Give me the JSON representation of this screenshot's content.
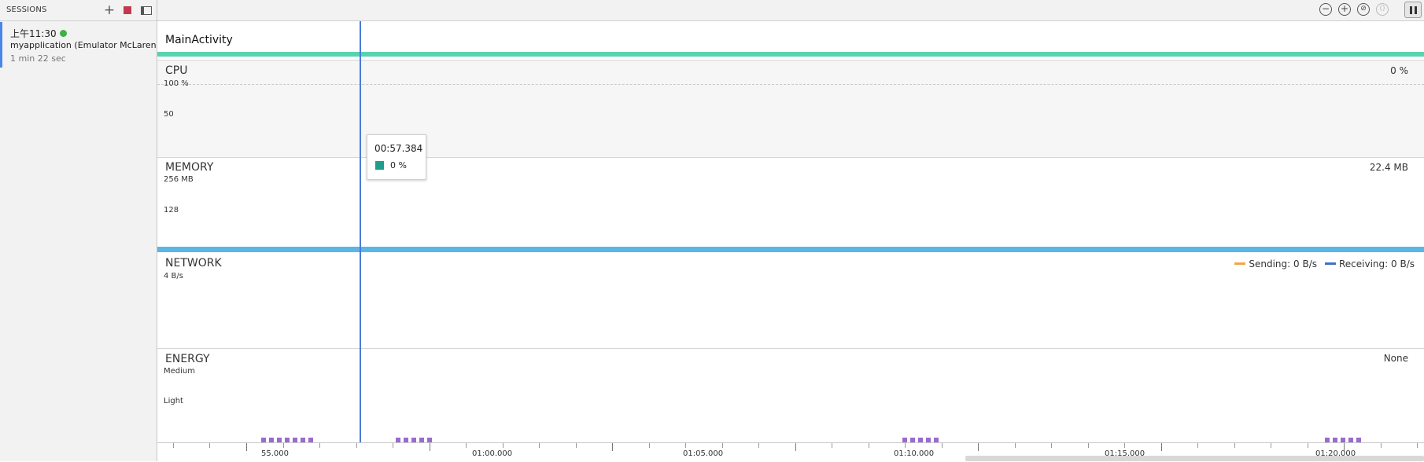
{
  "sessions": {
    "header": "SESSIONS",
    "item": {
      "time": "上午11:30",
      "app": "myapplication (Emulator McLarenP...",
      "duration": "1 min 22 sec"
    }
  },
  "activity": {
    "title": "MainActivity"
  },
  "cpu": {
    "title": "CPU",
    "value": "0 %",
    "tick_max": "100 %",
    "tick_mid": "50"
  },
  "memory": {
    "title": "MEMORY",
    "value": "22.4 MB",
    "tick_max": "256 MB",
    "tick_mid": "128"
  },
  "network": {
    "title": "NETWORK",
    "tick_max": "4 B/s",
    "sending": "Sending: 0 B/s",
    "receiving": "Receiving: 0 B/s"
  },
  "energy": {
    "title": "ENERGY",
    "value": "None",
    "tick_medium": "Medium",
    "tick_light": "Light"
  },
  "tooltip": {
    "time": "00:57.384",
    "value": "0 %"
  },
  "axis": {
    "labels": [
      "55.000",
      "01:00.000",
      "01:05.000",
      "01:10.000",
      "01:15.000",
      "01:20.000"
    ]
  },
  "colors": {
    "activity": "#58d3b0",
    "memory": "#5bb6e6",
    "cursor": "#4a7bd8",
    "energy": "#9b6ad0",
    "sending": "#f2a74b",
    "receiving": "#3f72c9",
    "recording": "#3eb049"
  }
}
